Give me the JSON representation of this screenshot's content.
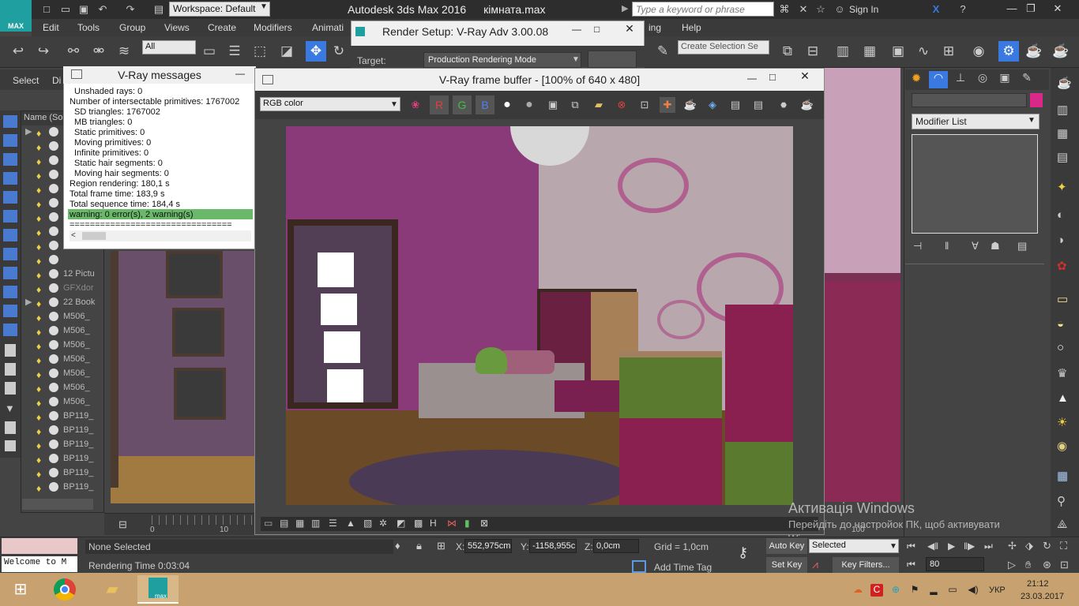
{
  "title_bar": {
    "workspace": "Workspace: Default",
    "app_title": "Autodesk 3ds Max 2016",
    "file_name": "кімната.max",
    "search_placeholder": "Type a keyword or phrase",
    "sign_in": "Sign In",
    "logo_text": "MAX"
  },
  "menus": [
    "Edit",
    "Tools",
    "Group",
    "Views",
    "Create",
    "Modifiers",
    "Animati",
    "ing",
    "Help"
  ],
  "toolbar": {
    "selection_filter": "All",
    "create_selection_set": "Create Selection Se"
  },
  "explorer": {
    "select_label": "Select",
    "di_label": "Di",
    "column_header": "Name (Sor",
    "rows": [
      "",
      "",
      "",
      "",
      "",
      "",
      "",
      "",
      "",
      "",
      "12 Pictu",
      "GFXdor",
      "22 Book",
      "M506_",
      "M506_",
      "M506_",
      "M506_",
      "M506_",
      "M506_",
      "M506_",
      "BP119_",
      "BP119_",
      "BP119_",
      "BP119_",
      "BP119_",
      "BP119_"
    ]
  },
  "vray_messages": {
    "title": "V-Ray messages",
    "lines": [
      "Unshaded rays: 0",
      "Number of intersectable primitives: 1767002",
      "SD triangles: 1767002",
      "MB triangles: 0",
      "Static primitives: 0",
      "Moving primitives: 0",
      "Infinite primitives: 0",
      "Static hair segments: 0",
      "Moving hair segments: 0",
      "Region rendering: 180,1 s",
      "Total frame time: 183,9 s",
      "Total sequence time: 184,4 s",
      "warning: 0 error(s), 2 warning(s)",
      "================================"
    ]
  },
  "render_setup": {
    "title": "Render Setup: V-Ray Adv 3.00.08",
    "target_label": "Target:",
    "target_value": "Production Rendering Mode"
  },
  "frame_buffer": {
    "title": "V-Ray frame buffer - [100% of 640 x 480]",
    "channel": "RGB color",
    "r": "R",
    "g": "G",
    "b": "B"
  },
  "command_panel": {
    "modifier_list": "Modifier List",
    "object_color": "#d8288a"
  },
  "timeline": {
    "tick_0": "0",
    "tick_10": "10",
    "tick_100": "100"
  },
  "status": {
    "selection": "None Selected",
    "render_time": "Rendering Time  0:03:04",
    "maxscript": "Welcome to M",
    "x_label": "X:",
    "x_value": "552,975cm",
    "y_label": "Y:",
    "y_value": "-1158,955c",
    "z_label": "Z:",
    "z_value": "0,0cm",
    "grid": "Grid = 1,0cm",
    "add_time_tag": "Add Time Tag",
    "auto_key": "Auto Key",
    "set_key": "Set Key",
    "key_mode": "Selected",
    "key_filters": "Key Filters...",
    "frame": "80"
  },
  "watermark": {
    "line1": "Активація Windows",
    "line2": "Перейдіть до настройок ПК, щоб активувати",
    "line3": "Wi"
  },
  "taskbar": {
    "lang": "УКР",
    "time": "21:12",
    "date": "23.03.2017",
    "max_label": "max"
  }
}
